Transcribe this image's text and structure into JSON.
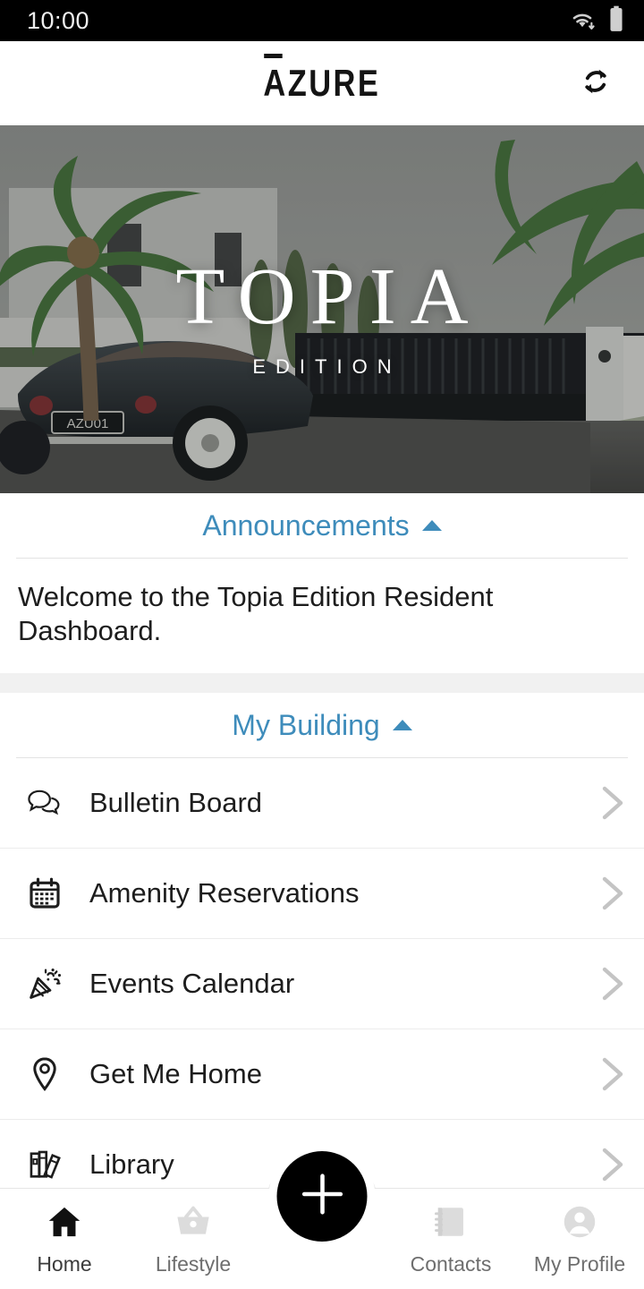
{
  "status_bar": {
    "time": "10:00",
    "icons": [
      "wifi-icon",
      "battery-icon"
    ]
  },
  "app_bar": {
    "brand": "ĀZURE",
    "brand_plain": "AZURE",
    "refresh_icon": "refresh-icon"
  },
  "hero": {
    "title": "TOPIA",
    "subtitle": "EDITION",
    "license_plate": "AZU01",
    "alt": "Classic dark convertible car parked in front of a black gate with palm trees"
  },
  "announcements": {
    "title": "Announcements",
    "collapse_icon": "caret-up-icon",
    "body": "Welcome to the Topia Edition Resident Dashboard."
  },
  "my_building": {
    "title": "My Building",
    "collapse_icon": "caret-up-icon",
    "items": [
      {
        "label": "Bulletin Board",
        "icon": "speech-bubbles-icon"
      },
      {
        "label": "Amenity Reservations",
        "icon": "calendar-icon"
      },
      {
        "label": "Events Calendar",
        "icon": "party-popper-icon"
      },
      {
        "label": "Get Me Home",
        "icon": "location-pin-icon"
      },
      {
        "label": "Library",
        "icon": "books-icon"
      }
    ]
  },
  "bottom_nav": {
    "items": [
      {
        "label": "Home",
        "icon": "home-icon",
        "active": true
      },
      {
        "label": "Lifestyle",
        "icon": "basket-icon",
        "active": false
      },
      {
        "label": "Contacts",
        "icon": "address-book-icon",
        "active": false
      },
      {
        "label": "My Profile",
        "icon": "avatar-icon",
        "active": false
      }
    ],
    "fab": {
      "label": "+",
      "icon": "plus-icon"
    }
  },
  "colors": {
    "accent_blue": "#3e8cbb",
    "text_primary": "#1d1d1d",
    "status_bar_bg": "#000000",
    "fab_bg": "#000000",
    "muted_icon": "#d8d8d8",
    "section_gap": "#f1f1f1"
  }
}
